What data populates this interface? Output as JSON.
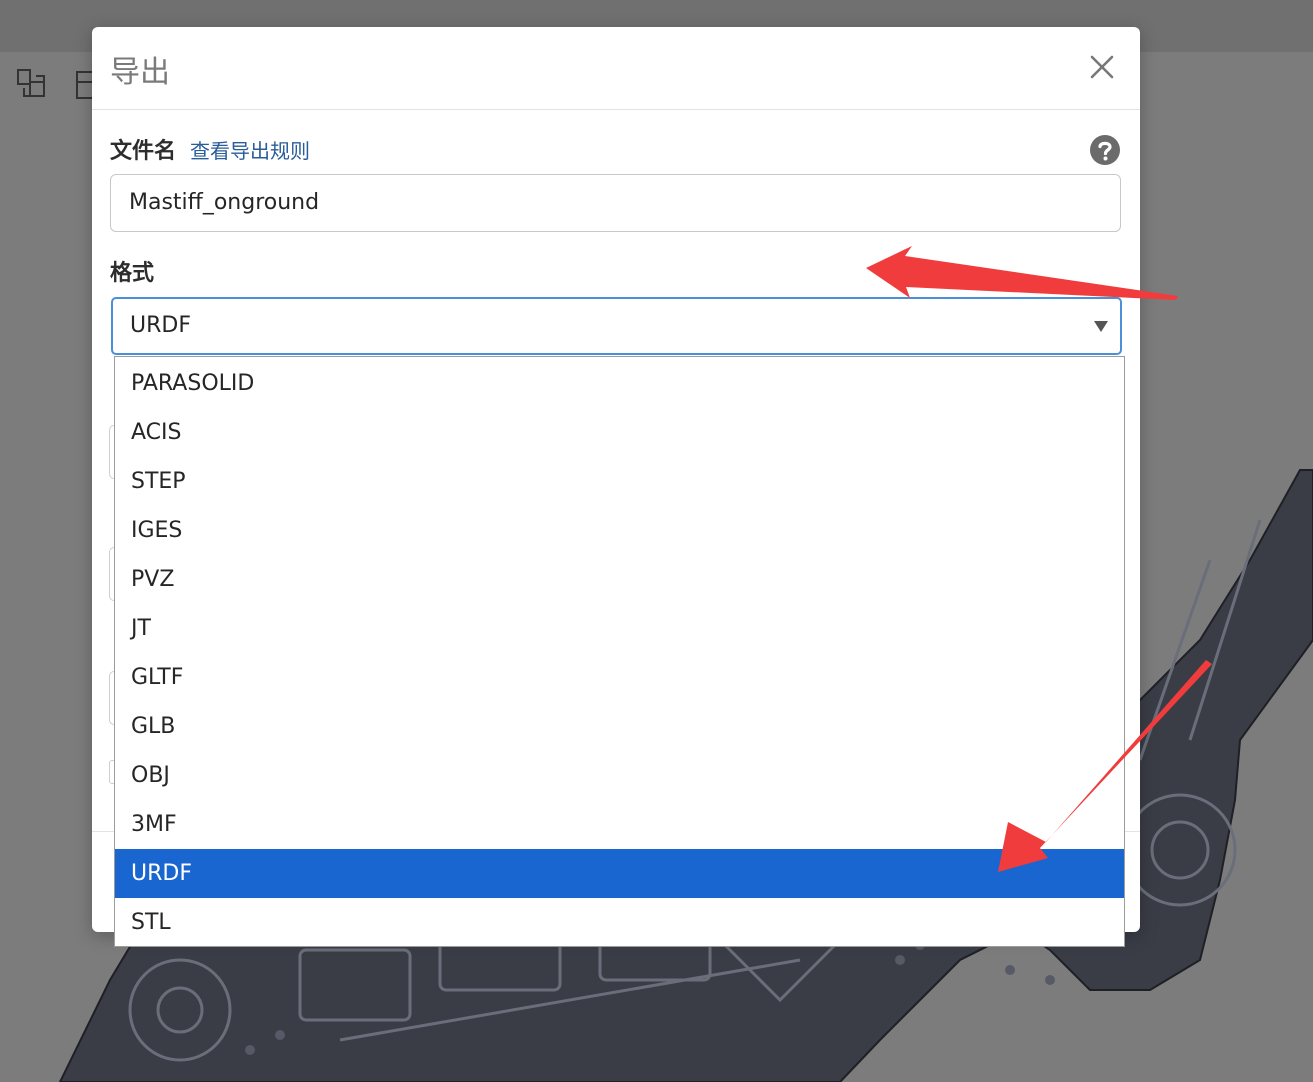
{
  "dialog": {
    "title": "导出",
    "close_icon": "close-icon",
    "filename": {
      "label": "文件名",
      "rules_link": "查看导出规则",
      "help_icon": "question-circle-icon",
      "value": "Mastiff_onground"
    },
    "format": {
      "label": "格式",
      "selected": "URDF",
      "options": [
        "PARASOLID",
        "ACIS",
        "STEP",
        "IGES",
        "PVZ",
        "JT",
        "GLTF",
        "GLB",
        "OBJ",
        "3MF",
        "URDF",
        "STL"
      ]
    }
  },
  "annotation": {
    "arrow_color": "#f03c3c"
  },
  "colors": {
    "selected_option": "#1a66d0",
    "select_border": "#4a90d9",
    "link": "#2a5d9a"
  }
}
